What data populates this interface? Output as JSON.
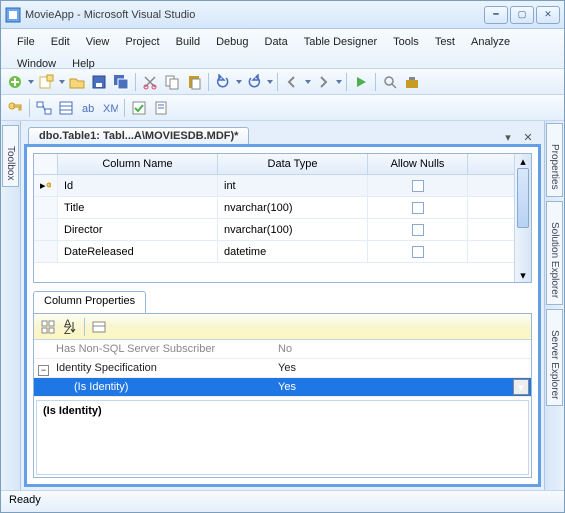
{
  "window": {
    "title": "MovieApp - Microsoft Visual Studio"
  },
  "menu": [
    "File",
    "Edit",
    "View",
    "Project",
    "Build",
    "Debug",
    "Data",
    "Table Designer",
    "Tools",
    "Test",
    "Analyze",
    "Window",
    "Help"
  ],
  "doc_tab": "dbo.Table1: Tabl...A\\MOVIESDB.MDF)*",
  "left_dock": {
    "tab": "Toolbox"
  },
  "right_dock": {
    "tabs": [
      "Properties",
      "Solution Explorer",
      "Server Explorer"
    ]
  },
  "designer": {
    "headers": {
      "col": "Column Name",
      "type": "Data Type",
      "nulls": "Allow Nulls"
    },
    "rows": [
      {
        "key": true,
        "name": "Id",
        "type": "int",
        "nulls": false
      },
      {
        "key": false,
        "name": "Title",
        "type": "nvarchar(100)",
        "nulls": false
      },
      {
        "key": false,
        "name": "Director",
        "type": "nvarchar(100)",
        "nulls": false
      },
      {
        "key": false,
        "name": "DateReleased",
        "type": "datetime",
        "nulls": false
      }
    ]
  },
  "props": {
    "tab": "Column Properties",
    "rows": [
      {
        "label": "Has Non-SQL Server Subscriber",
        "value": "No",
        "gray": true
      },
      {
        "label": "Identity Specification",
        "value": "Yes",
        "expander": "-"
      },
      {
        "label": "(Is Identity)",
        "value": "Yes",
        "selected": true,
        "indent": true
      }
    ],
    "desc": "(Is Identity)"
  },
  "status": "Ready"
}
